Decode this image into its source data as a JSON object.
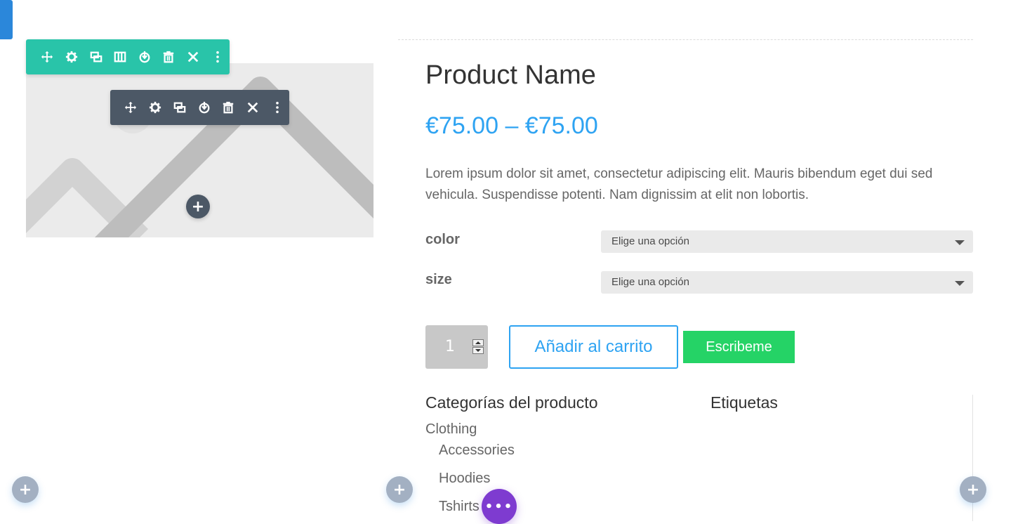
{
  "colors": {
    "accent_blue": "#2ea3f2",
    "row_toolbar": "#29c4a9",
    "module_toolbar": "#4c5866",
    "whatsapp_green": "#25d366",
    "purple": "#7e3bd0",
    "add_blue": "#a3b0c2"
  },
  "row_toolbar": {
    "icons": [
      "move-icon",
      "gear-icon",
      "duplicate-icon",
      "columns-icon",
      "save-icon",
      "trash-icon",
      "close-icon",
      "more-icon"
    ]
  },
  "module_toolbar": {
    "icons": [
      "move-icon",
      "gear-icon",
      "duplicate-icon",
      "save-icon",
      "trash-icon",
      "close-icon",
      "more-icon"
    ]
  },
  "product": {
    "name": "Product Name",
    "price": "€75.00 – €75.00",
    "description": "Lorem ipsum dolor sit amet, consectetur adipiscing elit. Mauris bibendum eget dui sed vehicula. Suspendisse potenti. Nam dignissim at elit non lobortis.",
    "variations": [
      {
        "label": "color",
        "selected": "Elige una opción"
      },
      {
        "label": "size",
        "selected": "Elige una opción"
      }
    ],
    "quantity": "1",
    "add_to_cart": "Añadir al carrito",
    "whatsapp_button": "Escribeme"
  },
  "meta": {
    "categories_heading": "Categorías del producto",
    "tags_heading": "Etiquetas",
    "categories": [
      "Clothing",
      "Accessories",
      "Hoodies",
      "Tshirts"
    ]
  },
  "builder": {
    "add_symbol": "+",
    "more_symbol": "•••"
  }
}
